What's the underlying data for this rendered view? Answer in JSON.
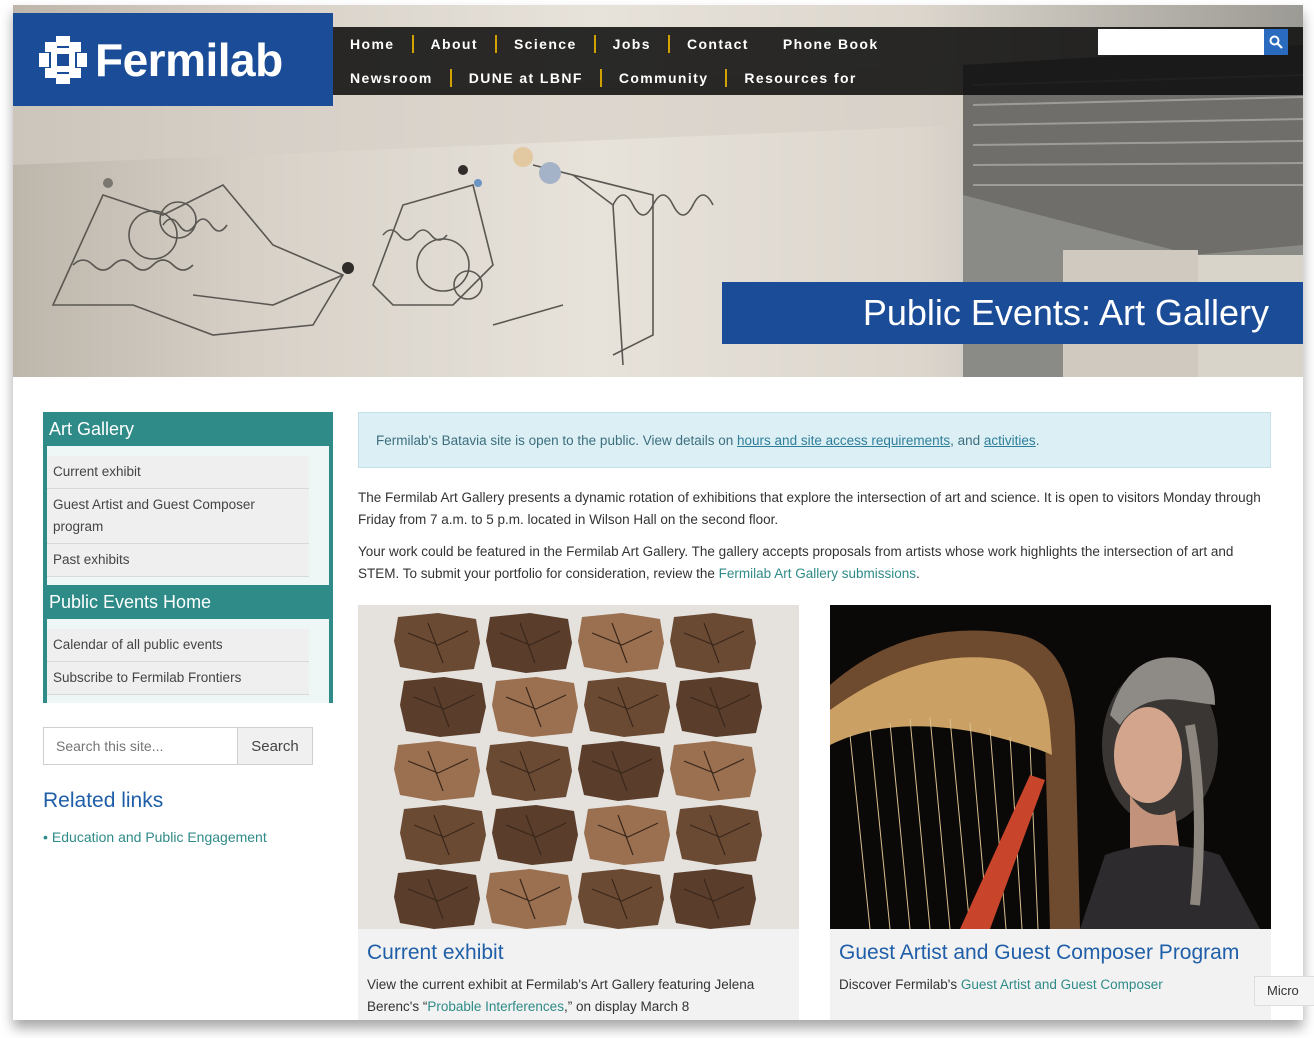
{
  "brand": {
    "logo_text": "Fermilab"
  },
  "nav": {
    "row1": [
      "Home",
      "About",
      "Science",
      "Jobs",
      "Contact",
      "Phone Book"
    ],
    "row2": [
      "Newsroom",
      "DUNE at LBNF",
      "Community",
      "Resources for"
    ]
  },
  "top_search": {
    "placeholder": ""
  },
  "hero": {
    "title": "Public Events: Art Gallery"
  },
  "sidebar": {
    "group1": {
      "title": "Art Gallery",
      "links": [
        "Current exhibit",
        "Guest Artist and Guest Composer program",
        "Past exhibits"
      ]
    },
    "group2": {
      "title": "Public Events Home",
      "links": [
        "Calendar of all public events",
        "Subscribe to Fermilab Frontiers"
      ]
    },
    "search": {
      "placeholder": "Search this site...",
      "button": "Search"
    },
    "related": {
      "title": "Related links",
      "links": [
        "Education and Public Engagement"
      ]
    }
  },
  "notice": {
    "text_before": "Fermilab's Batavia site is open to the public. View details on ",
    "link1": "hours and site access requirements",
    "text_mid": ", and ",
    "link2": "activities",
    "text_after": "."
  },
  "intro": {
    "p1": "The Fermilab Art Gallery presents a dynamic rotation of exhibitions that explore the intersection of art and science. It is open to visitors Monday through Friday from 7 a.m. to 5 p.m. located in Wilson Hall on the second floor.",
    "p2_before": "Your work could be featured in the Fermilab Art Gallery. The gallery accepts proposals from artists whose work highlights the intersection of art and STEM. To submit your portfolio for consideration, review the ",
    "p2_link": "Fermilab Art Gallery submissions",
    "p2_after": "."
  },
  "cards": [
    {
      "title": "Current exhibit",
      "text_before": "View the current exhibit at Fermilab's Art Gallery featuring Jelena Berenc's “",
      "link": "Probable Interferences",
      "text_after": ",” on display March 8"
    },
    {
      "title": "Guest Artist and Guest Composer Program",
      "text_before": "Discover Fermilab's ",
      "link": "Guest Artist and Guest Composer",
      "text_after": ""
    }
  ],
  "micro_tab": "Micro",
  "colors": {
    "brand_blue": "#1b4c97",
    "teal": "#2e8b88",
    "nav_separator": "#d1a200",
    "link_blue": "#1f5ea8"
  }
}
